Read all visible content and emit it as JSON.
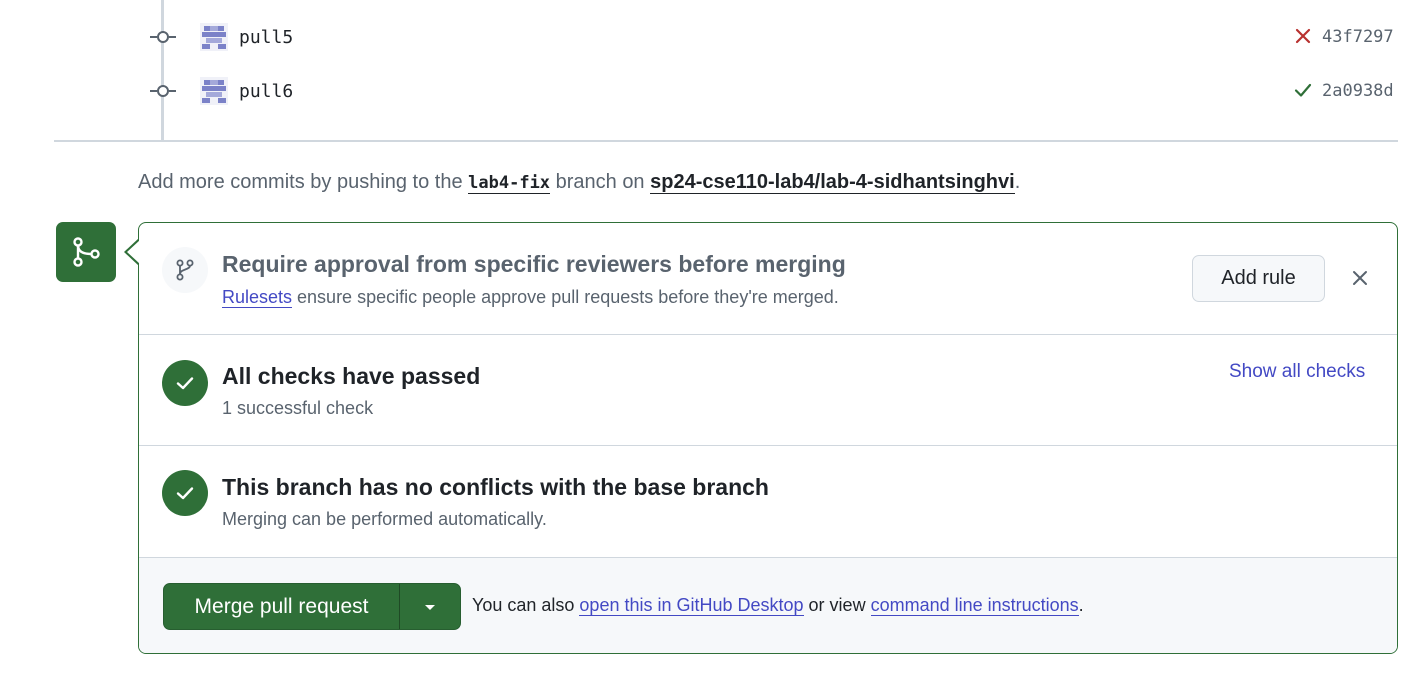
{
  "commits": [
    {
      "message": "pull5",
      "status": "failure",
      "status_icon": "x-icon",
      "sha": "43f7297"
    },
    {
      "message": "pull6",
      "status": "success",
      "status_icon": "check-icon",
      "sha": "2a0938d"
    }
  ],
  "push_hint": {
    "prefix": "Add more commits by pushing to the ",
    "branch": "lab4-fix",
    "middle": " branch on ",
    "repo": "sp24-cse110-lab4/lab-4-sidhantsinghvi",
    "suffix": "."
  },
  "ruleset_notice": {
    "title": "Require approval from specific reviewers before merging",
    "link_text": "Rulesets",
    "description": " ensure specific people approve pull requests before they're merged.",
    "add_rule_label": "Add rule"
  },
  "checks": {
    "title": "All checks have passed",
    "subtitle": "1 successful check",
    "show_all_label": "Show all checks"
  },
  "conflicts": {
    "title": "This branch has no conflicts with the base branch",
    "subtitle": "Merging can be performed automatically."
  },
  "merge": {
    "button_label": "Merge pull request",
    "alt_prefix": "You can also ",
    "desktop_link": "open this in GitHub Desktop",
    "alt_middle": " or view ",
    "cli_link": "command line instructions",
    "alt_suffix": "."
  },
  "colors": {
    "success_green": "#2f6f38",
    "failure_red": "#b8312f",
    "link_blue": "#4349c4"
  }
}
